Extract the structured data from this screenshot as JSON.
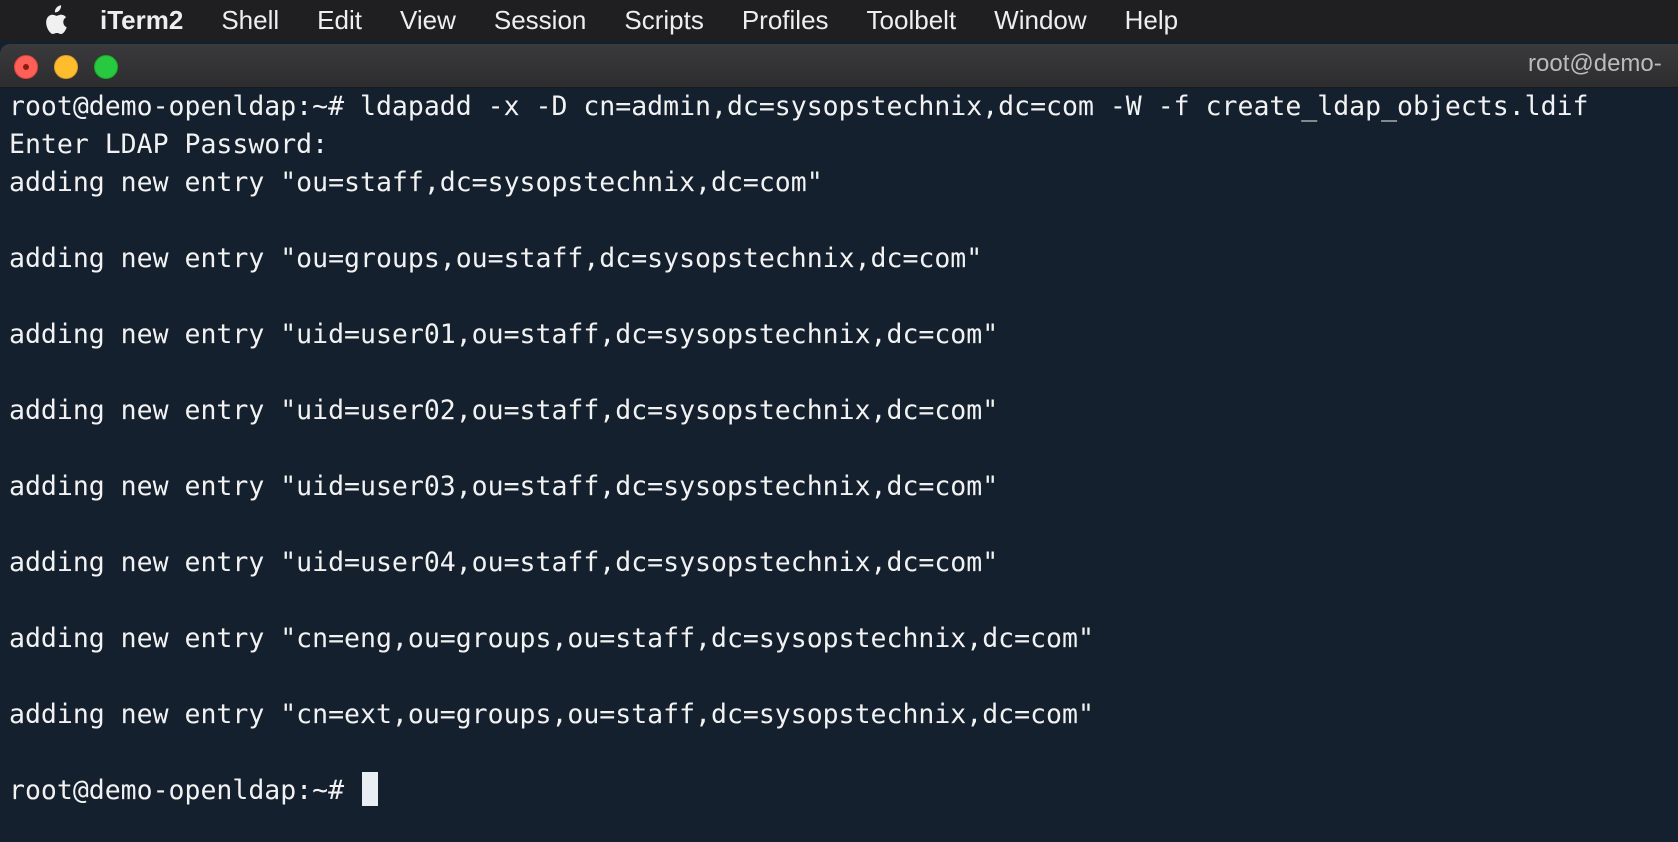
{
  "menubar": {
    "apple_icon": "apple-icon",
    "app_name": "iTerm2",
    "items": [
      "Shell",
      "Edit",
      "View",
      "Session",
      "Scripts",
      "Profiles",
      "Toolbelt",
      "Window",
      "Help"
    ]
  },
  "window": {
    "title": "root@demo-"
  },
  "terminal": {
    "lines": [
      "root@demo-openldap:~# ldapadd -x -D cn=admin,dc=sysopstechnix,dc=com -W -f create_ldap_objects.ldif",
      "Enter LDAP Password:",
      "adding new entry \"ou=staff,dc=sysopstechnix,dc=com\"",
      "",
      "adding new entry \"ou=groups,ou=staff,dc=sysopstechnix,dc=com\"",
      "",
      "adding new entry \"uid=user01,ou=staff,dc=sysopstechnix,dc=com\"",
      "",
      "adding new entry \"uid=user02,ou=staff,dc=sysopstechnix,dc=com\"",
      "",
      "adding new entry \"uid=user03,ou=staff,dc=sysopstechnix,dc=com\"",
      "",
      "adding new entry \"uid=user04,ou=staff,dc=sysopstechnix,dc=com\"",
      "",
      "adding new entry \"cn=eng,ou=groups,ou=staff,dc=sysopstechnix,dc=com\"",
      "",
      "adding new entry \"cn=ext,ou=groups,ou=staff,dc=sysopstechnix,dc=com\"",
      ""
    ],
    "prompt": "root@demo-openldap:~# "
  },
  "colors": {
    "terminal_bg": "#14202e",
    "terminal_fg": "#f2f2f2",
    "menubar_bg": "#1f1f21"
  }
}
